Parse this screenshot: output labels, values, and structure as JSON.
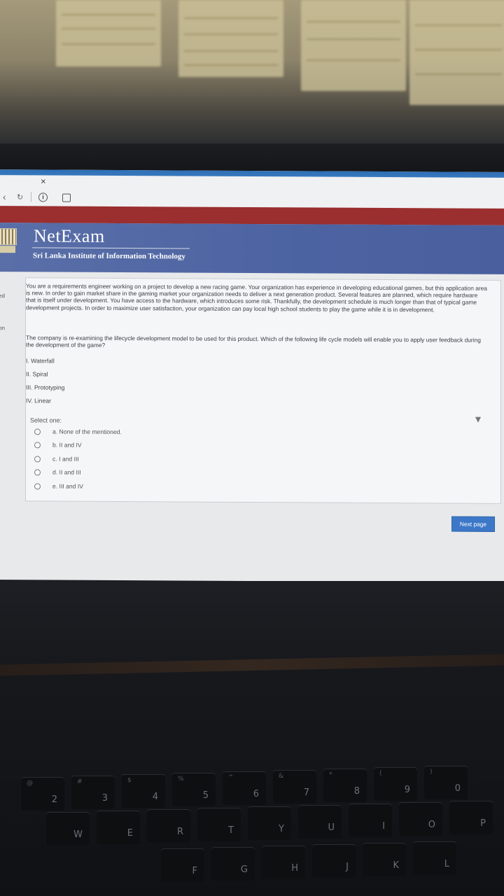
{
  "browser": {
    "close_symbol": "×",
    "back_icon": "chevron-left-icon",
    "reload_icon": "reload-icon",
    "info_icon": "info-icon",
    "extension_icon": "extension-icon"
  },
  "header": {
    "brand": "NetExam",
    "subtitle": "Sri Lanka Institute of Information Technology"
  },
  "sidebar_fragments": [
    "ed",
    "on"
  ],
  "question": {
    "paragraph1": "You are a requirements engineer working on a project to develop a new racing game. Your organization has experience in developing educational games, but this application area is new. In order to gain market share in the gaming market your organization needs to deliver a next generation product. Several features are planned, which require hardware that is itself under development. You have access to the hardware, which introduces some risk. Thankfully, the development schedule is much longer than that of typical game development projects. In order to maximize user satisfaction, your organization can pay local high school students to play the game while it is in development.",
    "paragraph2": "The company is re-examining the lifecycle development model to be used for this product. Which of the following life cycle models will enable you to apply user feedback during the development of the game?",
    "items": [
      "I. Waterfall",
      "II. Spiral",
      "III. Prototyping",
      "IV. Linear"
    ],
    "select_label": "Select one:",
    "choices": [
      "a. None of the mentioned.",
      "b. II and IV",
      "c. I and III",
      "d. II and III",
      "e. III and IV"
    ]
  },
  "next_button": "Next page",
  "keyboard": {
    "row1": [
      "2",
      "3",
      "4",
      "5",
      "6",
      "7",
      "8",
      "9",
      "0"
    ],
    "row1_symbols": [
      "@",
      "#",
      "$",
      "%",
      "^",
      "&",
      "*",
      "(",
      ")"
    ],
    "row2": [
      "W",
      "E",
      "R",
      "T",
      "Y",
      "U",
      "I",
      "O",
      "P"
    ],
    "row3": [
      "F",
      "G",
      "H",
      "J",
      "K",
      "L"
    ]
  },
  "colors": {
    "header_blue": "#4c63a2",
    "accent_red": "#9b2e2e",
    "button_blue": "#3d78c8"
  }
}
